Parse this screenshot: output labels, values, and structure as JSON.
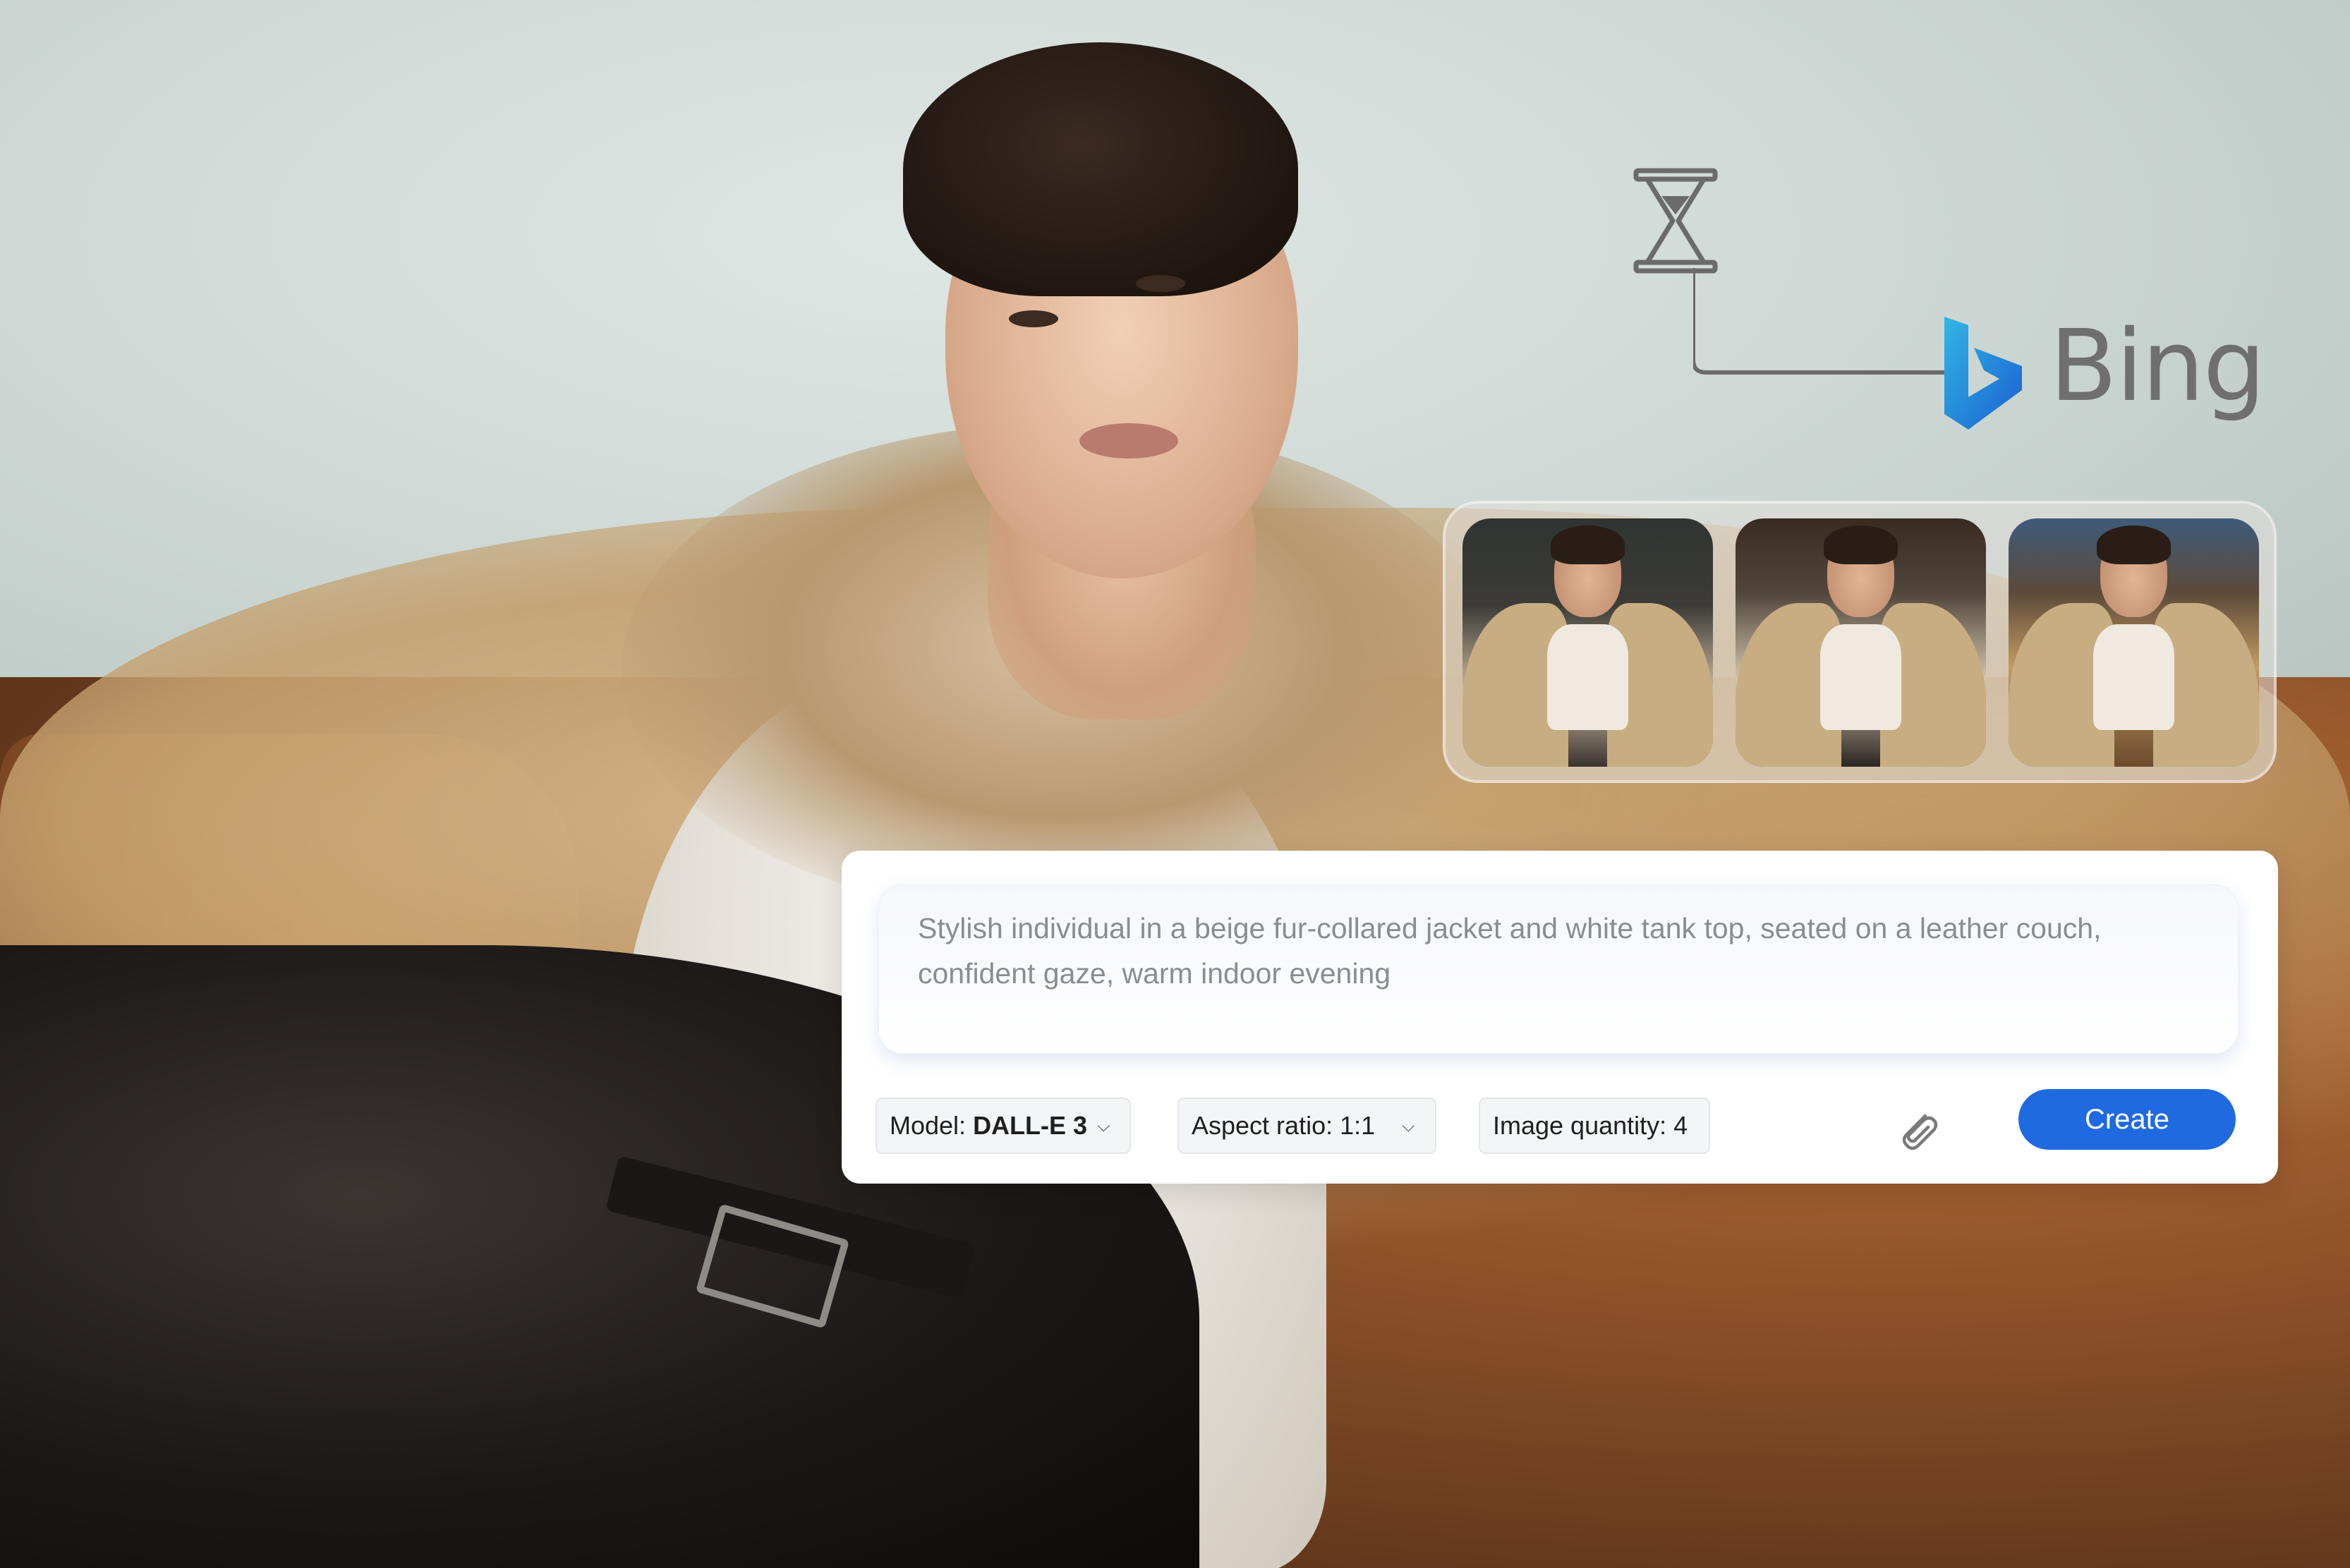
{
  "brand": {
    "name": "Bing",
    "text_color": "#6f6f6f",
    "logo_gradient": [
      "#32b6e6",
      "#1a5fcf"
    ]
  },
  "icons": {
    "hourglass": "hourglass-icon",
    "bing_logo": "bing-logo-icon",
    "attach": "paperclip-icon",
    "dropdown": "chevron-down-icon"
  },
  "thumbnails": {
    "count": 3,
    "items": [
      {
        "name": "generated-image-1"
      },
      {
        "name": "generated-image-2"
      },
      {
        "name": "generated-image-3"
      }
    ]
  },
  "prompt": {
    "text": "Stylish individual in a beige fur-collared jacket and white tank top, seated on a leather couch, confident gaze, warm indoor evening",
    "text_color": "#8a8c93"
  },
  "controls": {
    "model_label": "Model:",
    "model_value": "DALL-E 3",
    "aspect_label": "Aspect ratio: 1:1",
    "quantity_label": "Image quantity: 4",
    "create_label": "Create",
    "create_color": "#1f6ae0"
  }
}
